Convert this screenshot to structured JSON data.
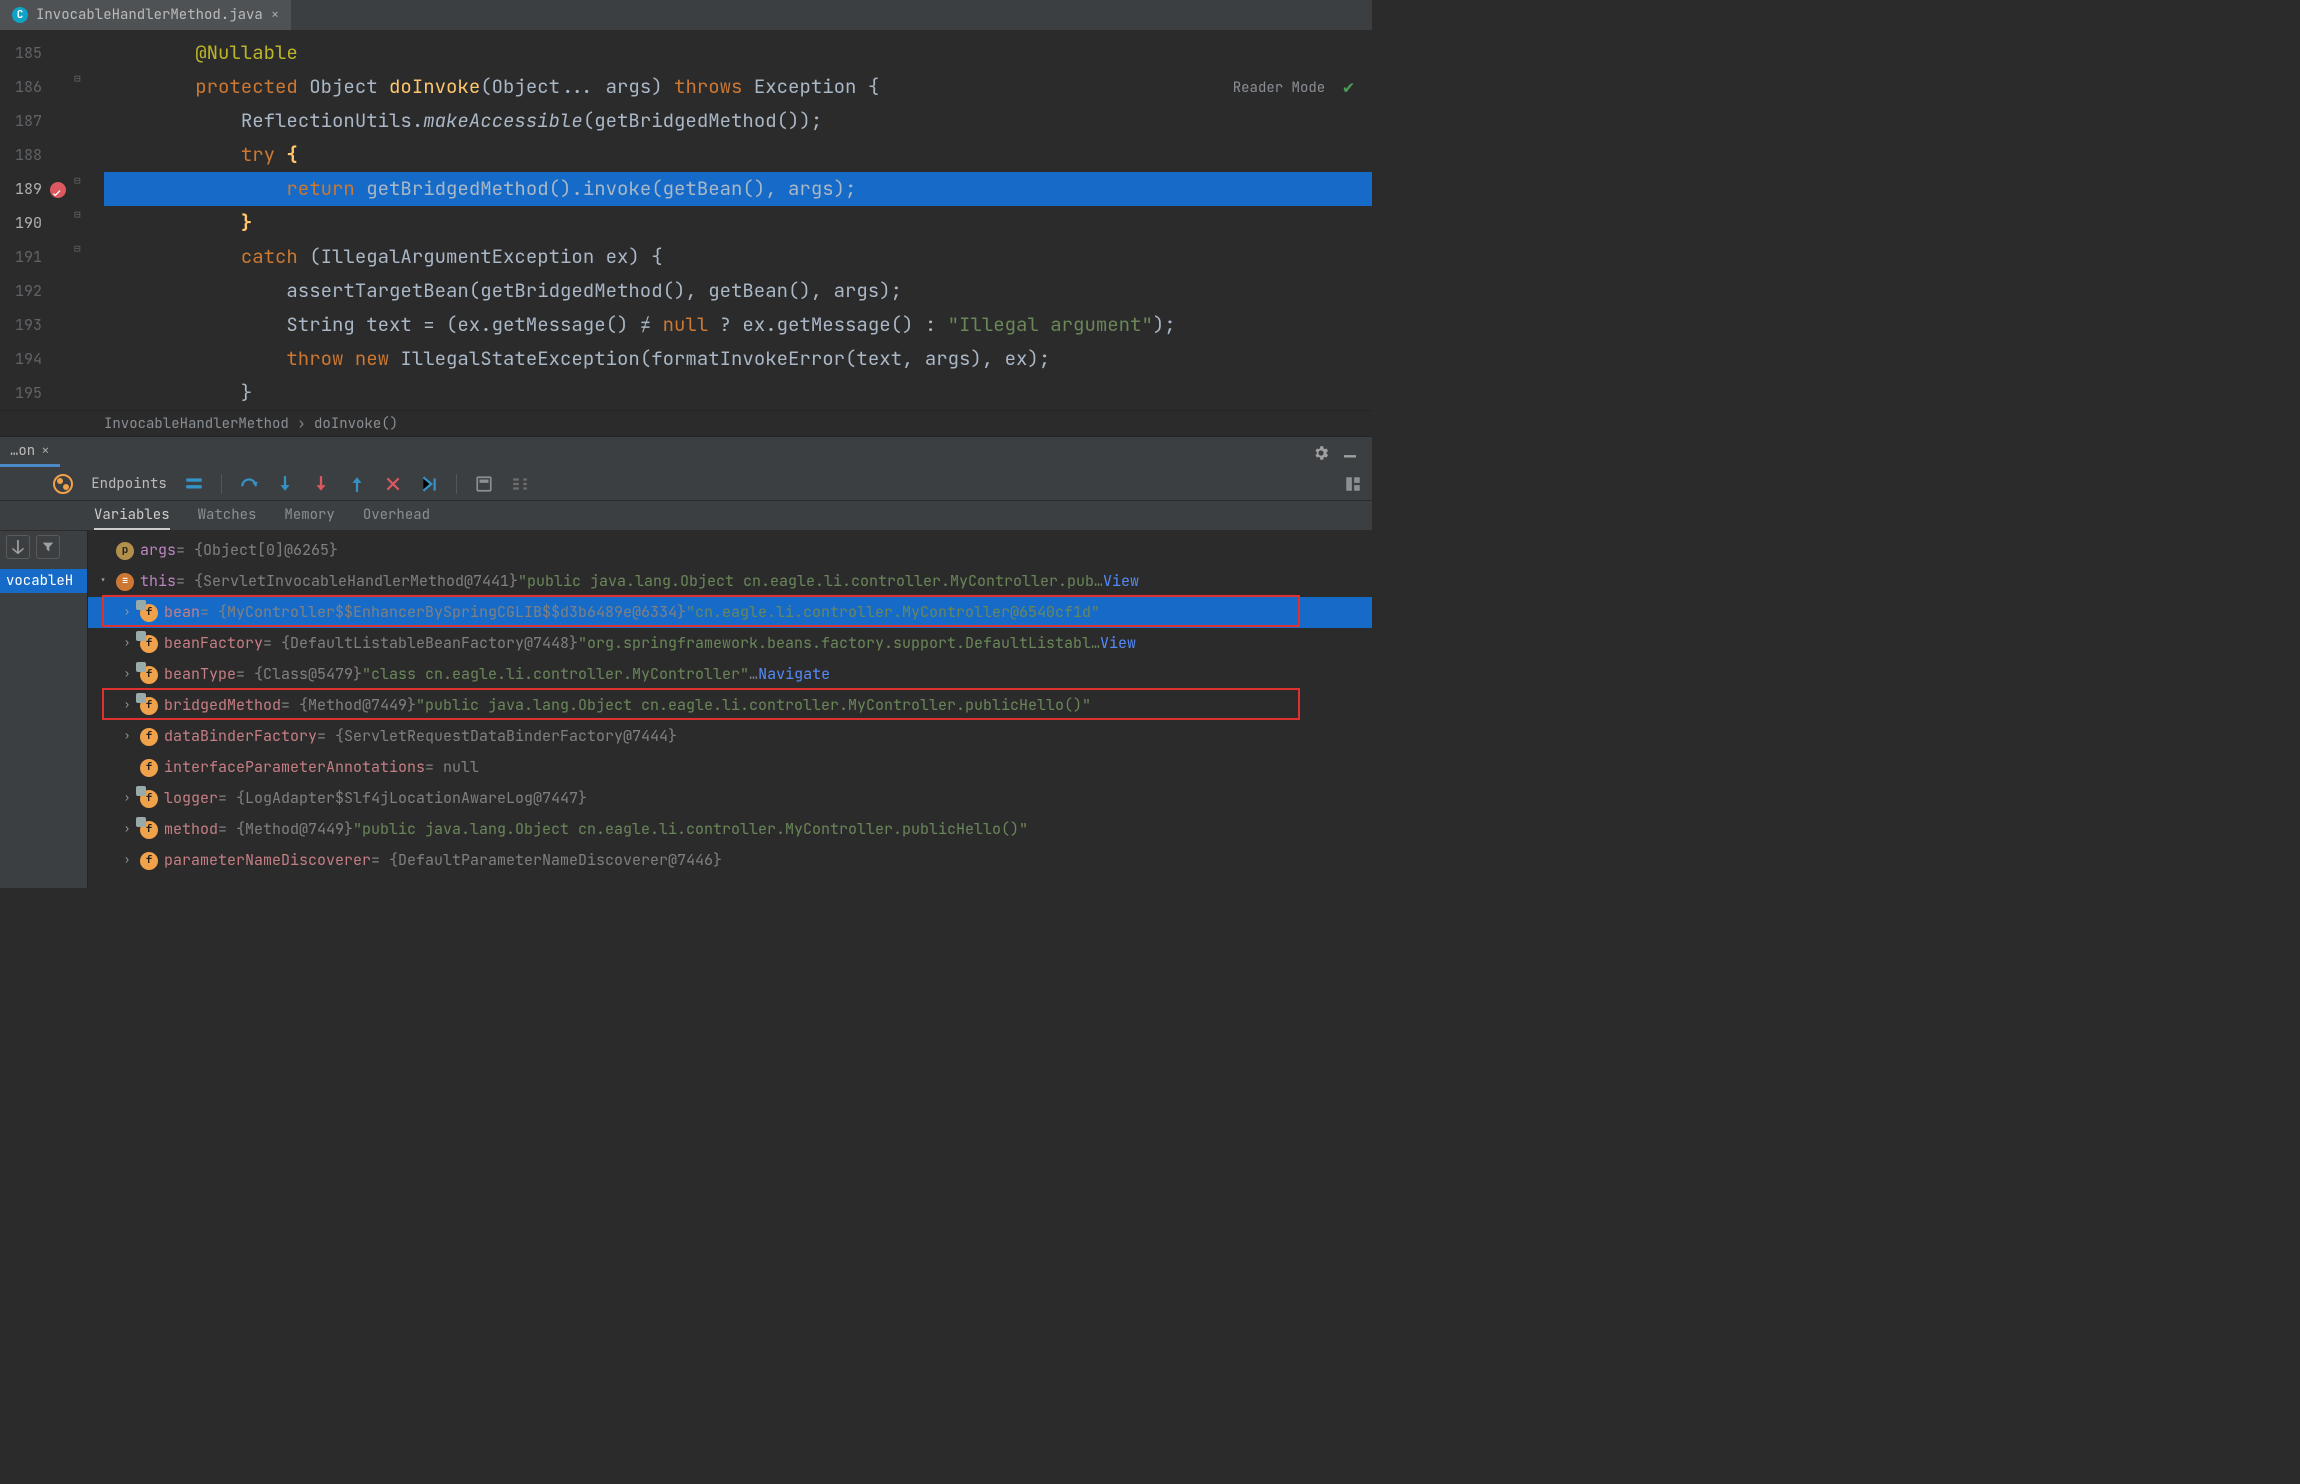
{
  "tab": {
    "filename": "InvocableHandlerMethod.java"
  },
  "topRight": {
    "readerMode": "Reader Mode"
  },
  "gutter": {
    "start": 185,
    "end": 195
  },
  "code": {
    "l185": {
      "indent": "        ",
      "annotation": "@Nullable"
    },
    "l186": {
      "indent": "        ",
      "kw1": "protected",
      "type": "Object",
      "method": "doInvoke",
      "sig": "(Object... args)",
      "kw2": "throws",
      "rest": "Exception {"
    },
    "l187": {
      "indent": "            ",
      "text1": "ReflectionUtils.",
      "it": "makeAccessible",
      "text2": "(getBridgedMethod());"
    },
    "l188": {
      "indent": "            ",
      "kw": "try",
      "br": " {"
    },
    "l189": {
      "indent": "                ",
      "kw": "return",
      "text": " getBridgedMethod().invoke(getBean(), args);"
    },
    "l190": {
      "indent": "            ",
      "br": "}"
    },
    "l191": {
      "indent": "            ",
      "kw": "catch",
      "text": " (IllegalArgumentException ex) {"
    },
    "l192": {
      "indent": "                ",
      "text": "assertTargetBean(getBridgedMethod(), getBean(), args);"
    },
    "l193": {
      "indent": "                ",
      "text1": "String text = (ex.getMessage() ",
      "ne": "≠",
      "kw": " null",
      "text2": " ? ex.getMessage() : ",
      "str": "\"Illegal argument\"",
      "text3": ");"
    },
    "l194": {
      "indent": "                ",
      "kw1": "throw",
      "kw2": " new",
      "text": " IllegalStateException(formatInvokeError(text, args), ex);"
    },
    "l195": {
      "indent": "            }",
      "text": ""
    }
  },
  "crumb": {
    "a": "InvocableHandlerMethod",
    "sep": " › ",
    "b": "doInvoke()"
  },
  "dbg": {
    "tab": "on",
    "endpoints": "Endpoints",
    "tabs2": [
      "Variables",
      "Watches",
      "Memory",
      "Overhead"
    ],
    "frameLabel": "vocableH",
    "rows": [
      {
        "depth": 0,
        "chev": "",
        "badge": "p",
        "name": "args",
        "gray": " = {Object[0]@6265}",
        "tail": ""
      },
      {
        "depth": 0,
        "chev": "v",
        "badge": "oo",
        "name": "this",
        "gray": " = {ServletInvocableHandlerMethod@7441} ",
        "str": "\"public java.lang.Object cn.eagle.li.controller.MyController.pub…",
        "link": " View"
      },
      {
        "depth": 1,
        "chev": ">",
        "badge": "f",
        "lock": true,
        "name": "bean",
        "gray": " = {MyController$$EnhancerBySpringCGLIB$$d3b6489e@6334} ",
        "str": "\"cn.eagle.li.controller.MyController@6540cf1d\"",
        "hl": true,
        "outline": true
      },
      {
        "depth": 1,
        "chev": ">",
        "badge": "f",
        "lock": true,
        "name": "beanFactory",
        "gray": " = {DefaultListableBeanFactory@7448} ",
        "str": "\"org.springframework.beans.factory.support.DefaultListabl…",
        "link": " View"
      },
      {
        "depth": 1,
        "chev": ">",
        "badge": "f",
        "lock": true,
        "name": "beanType",
        "gray": " = {Class@5479} ",
        "str": "\"class cn.eagle.li.controller.MyController\"",
        "extra": "…",
        "link": " Navigate"
      },
      {
        "depth": 1,
        "chev": ">",
        "badge": "f",
        "lock": true,
        "name": "bridgedMethod",
        "gray": " = {Method@7449} ",
        "str": "\"public java.lang.Object cn.eagle.li.controller.MyController.publicHello()\"",
        "outline": true
      },
      {
        "depth": 1,
        "chev": ">",
        "badge": "f",
        "name": "dataBinderFactory",
        "gray": " = {ServletRequestDataBinderFactory@7444}",
        "tail": ""
      },
      {
        "depth": 1,
        "chev": "",
        "badge": "f",
        "name": "interfaceParameterAnnotations",
        "gray": " = null",
        "tail": ""
      },
      {
        "depth": 1,
        "chev": ">",
        "badge": "f",
        "lock": true,
        "name": "logger",
        "gray": " = {LogAdapter$Slf4jLocationAwareLog@7447}",
        "tail": ""
      },
      {
        "depth": 1,
        "chev": ">",
        "badge": "f",
        "lock": true,
        "name": "method",
        "gray": " = {Method@7449} ",
        "str": "\"public java.lang.Object cn.eagle.li.controller.MyController.publicHello()\""
      },
      {
        "depth": 1,
        "chev": ">",
        "badge": "f",
        "name": "parameterNameDiscoverer",
        "gray": " = {DefaultParameterNameDiscoverer@7446}",
        "tail": ""
      }
    ]
  }
}
